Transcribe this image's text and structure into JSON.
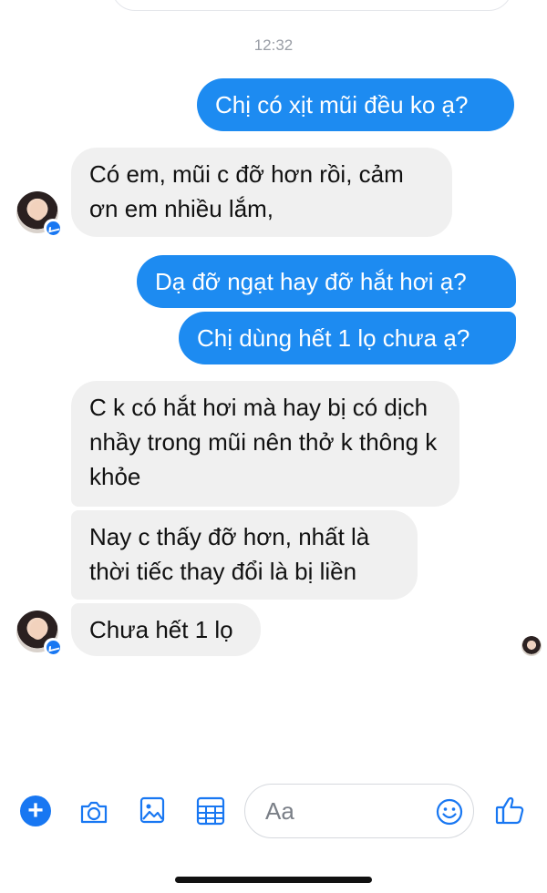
{
  "thread": {
    "timestamp": "12:32",
    "messages": [
      {
        "side": "out",
        "text": "Chị có xịt mũi đều ko ạ?"
      },
      {
        "side": "in",
        "text": "Có em, mũi c đỡ hơn rồi, cảm ơn em nhiều lắm,"
      },
      {
        "side": "out",
        "text": "Dạ đỡ ngạt hay đỡ hắt hơi ạ?"
      },
      {
        "side": "out",
        "text": "Chị dùng hết 1 lọ chưa ạ?"
      },
      {
        "side": "in",
        "text": "C k có hắt hơi mà hay bị có dịch nhầy trong mũi nên thở k thông k khỏe"
      },
      {
        "side": "in",
        "text": "Nay c thấy đỡ hơn, nhất là thời tiếc thay đổi là bị liền"
      },
      {
        "side": "in",
        "text": "Chưa hết 1 lọ"
      }
    ]
  },
  "composer": {
    "placeholder": "Aa",
    "icons": [
      "plus-icon",
      "camera-icon",
      "photo-icon",
      "sticker-icon",
      "emoji-icon",
      "like-icon"
    ]
  },
  "colors": {
    "outgoing_bubble": "#1d8bf1",
    "incoming_bubble": "#f0f0f0",
    "accent": "#1877f2"
  }
}
